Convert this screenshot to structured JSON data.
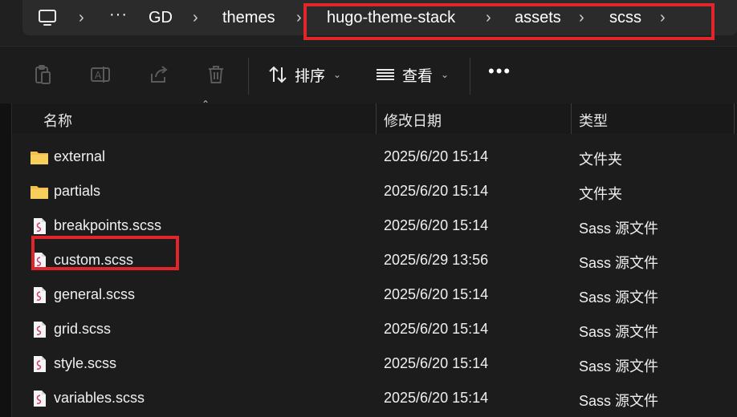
{
  "breadcrumb": {
    "items": [
      "GD",
      "themes",
      "hugo-theme-stack",
      "assets",
      "scss"
    ]
  },
  "toolbar": {
    "sort_label": "排序",
    "view_label": "查看"
  },
  "columns": {
    "name": "名称",
    "modified": "修改日期",
    "type": "类型"
  },
  "files": [
    {
      "name": "external",
      "modified": "2025/6/20 15:14",
      "type": "文件夹",
      "icon": "folder-icon"
    },
    {
      "name": "partials",
      "modified": "2025/6/20 15:14",
      "type": "文件夹",
      "icon": "folder-icon"
    },
    {
      "name": "breakpoints.scss",
      "modified": "2025/6/20 15:14",
      "type": "Sass 源文件",
      "icon": "sass-file-icon"
    },
    {
      "name": "custom.scss",
      "modified": "2025/6/29 13:56",
      "type": "Sass 源文件",
      "icon": "sass-file-icon"
    },
    {
      "name": "general.scss",
      "modified": "2025/6/20 15:14",
      "type": "Sass 源文件",
      "icon": "sass-file-icon"
    },
    {
      "name": "grid.scss",
      "modified": "2025/6/20 15:14",
      "type": "Sass 源文件",
      "icon": "sass-file-icon"
    },
    {
      "name": "style.scss",
      "modified": "2025/6/20 15:14",
      "type": "Sass 源文件",
      "icon": "sass-file-icon"
    },
    {
      "name": "variables.scss",
      "modified": "2025/6/20 15:14",
      "type": "Sass 源文件",
      "icon": "sass-file-icon"
    }
  ],
  "colors": {
    "highlight": "#e0262b",
    "folder": "#f4c04a",
    "background": "#1c1c1c"
  }
}
